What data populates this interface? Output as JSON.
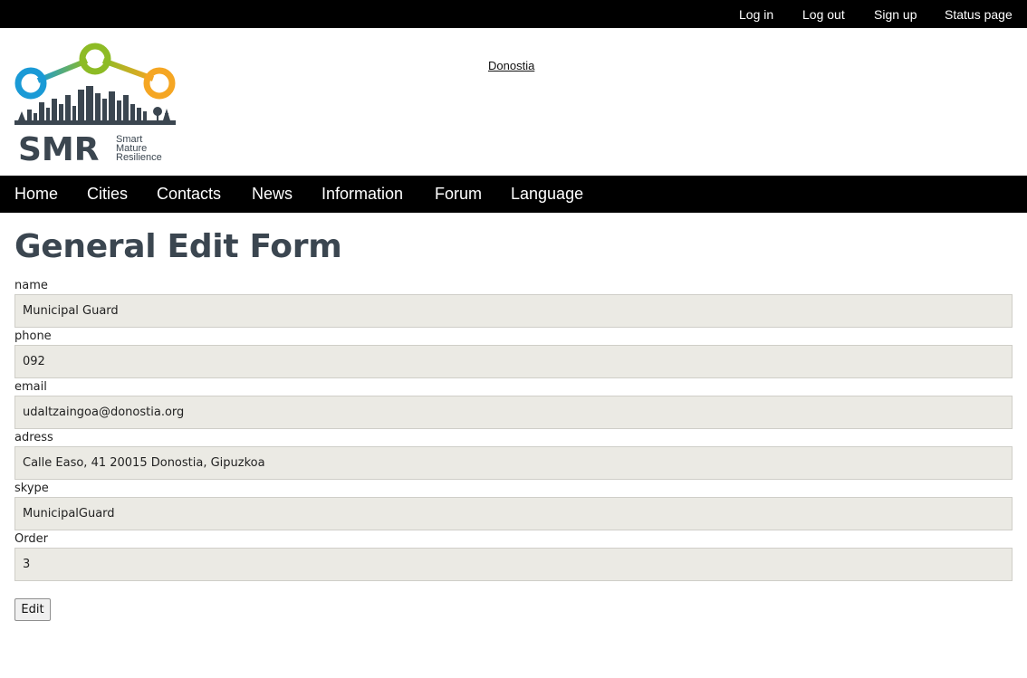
{
  "topbar": {
    "login": "Log in",
    "logout": "Log out",
    "signup": "Sign up",
    "status": "Status page"
  },
  "header": {
    "logo": {
      "abbr": "SMR",
      "line1": "Smart",
      "line2": "Mature",
      "line3": "Resilience",
      "colors": {
        "blue": "#1a9ad6",
        "green": "#8dbb25",
        "orange": "#f5a623",
        "dark": "#3b4650"
      }
    },
    "city_link": "Donostia"
  },
  "nav": {
    "home": "Home",
    "cities": "Cities",
    "contacts": "Contacts",
    "news": "News",
    "information": "Information",
    "forum": "Forum",
    "language": "Language"
  },
  "form": {
    "title": "General Edit Form",
    "fields": [
      {
        "label": "name",
        "value": "Municipal Guard"
      },
      {
        "label": "phone",
        "value": "092"
      },
      {
        "label": "email",
        "value": "udaltzaingoa@donostia.org"
      },
      {
        "label": "adress",
        "value": "Calle Easo, 41 20015 Donostia, Gipuzkoa"
      },
      {
        "label": "skype",
        "value": "MunicipalGuard"
      },
      {
        "label": "Order",
        "value": "3"
      }
    ],
    "submit_label": "Edit"
  }
}
